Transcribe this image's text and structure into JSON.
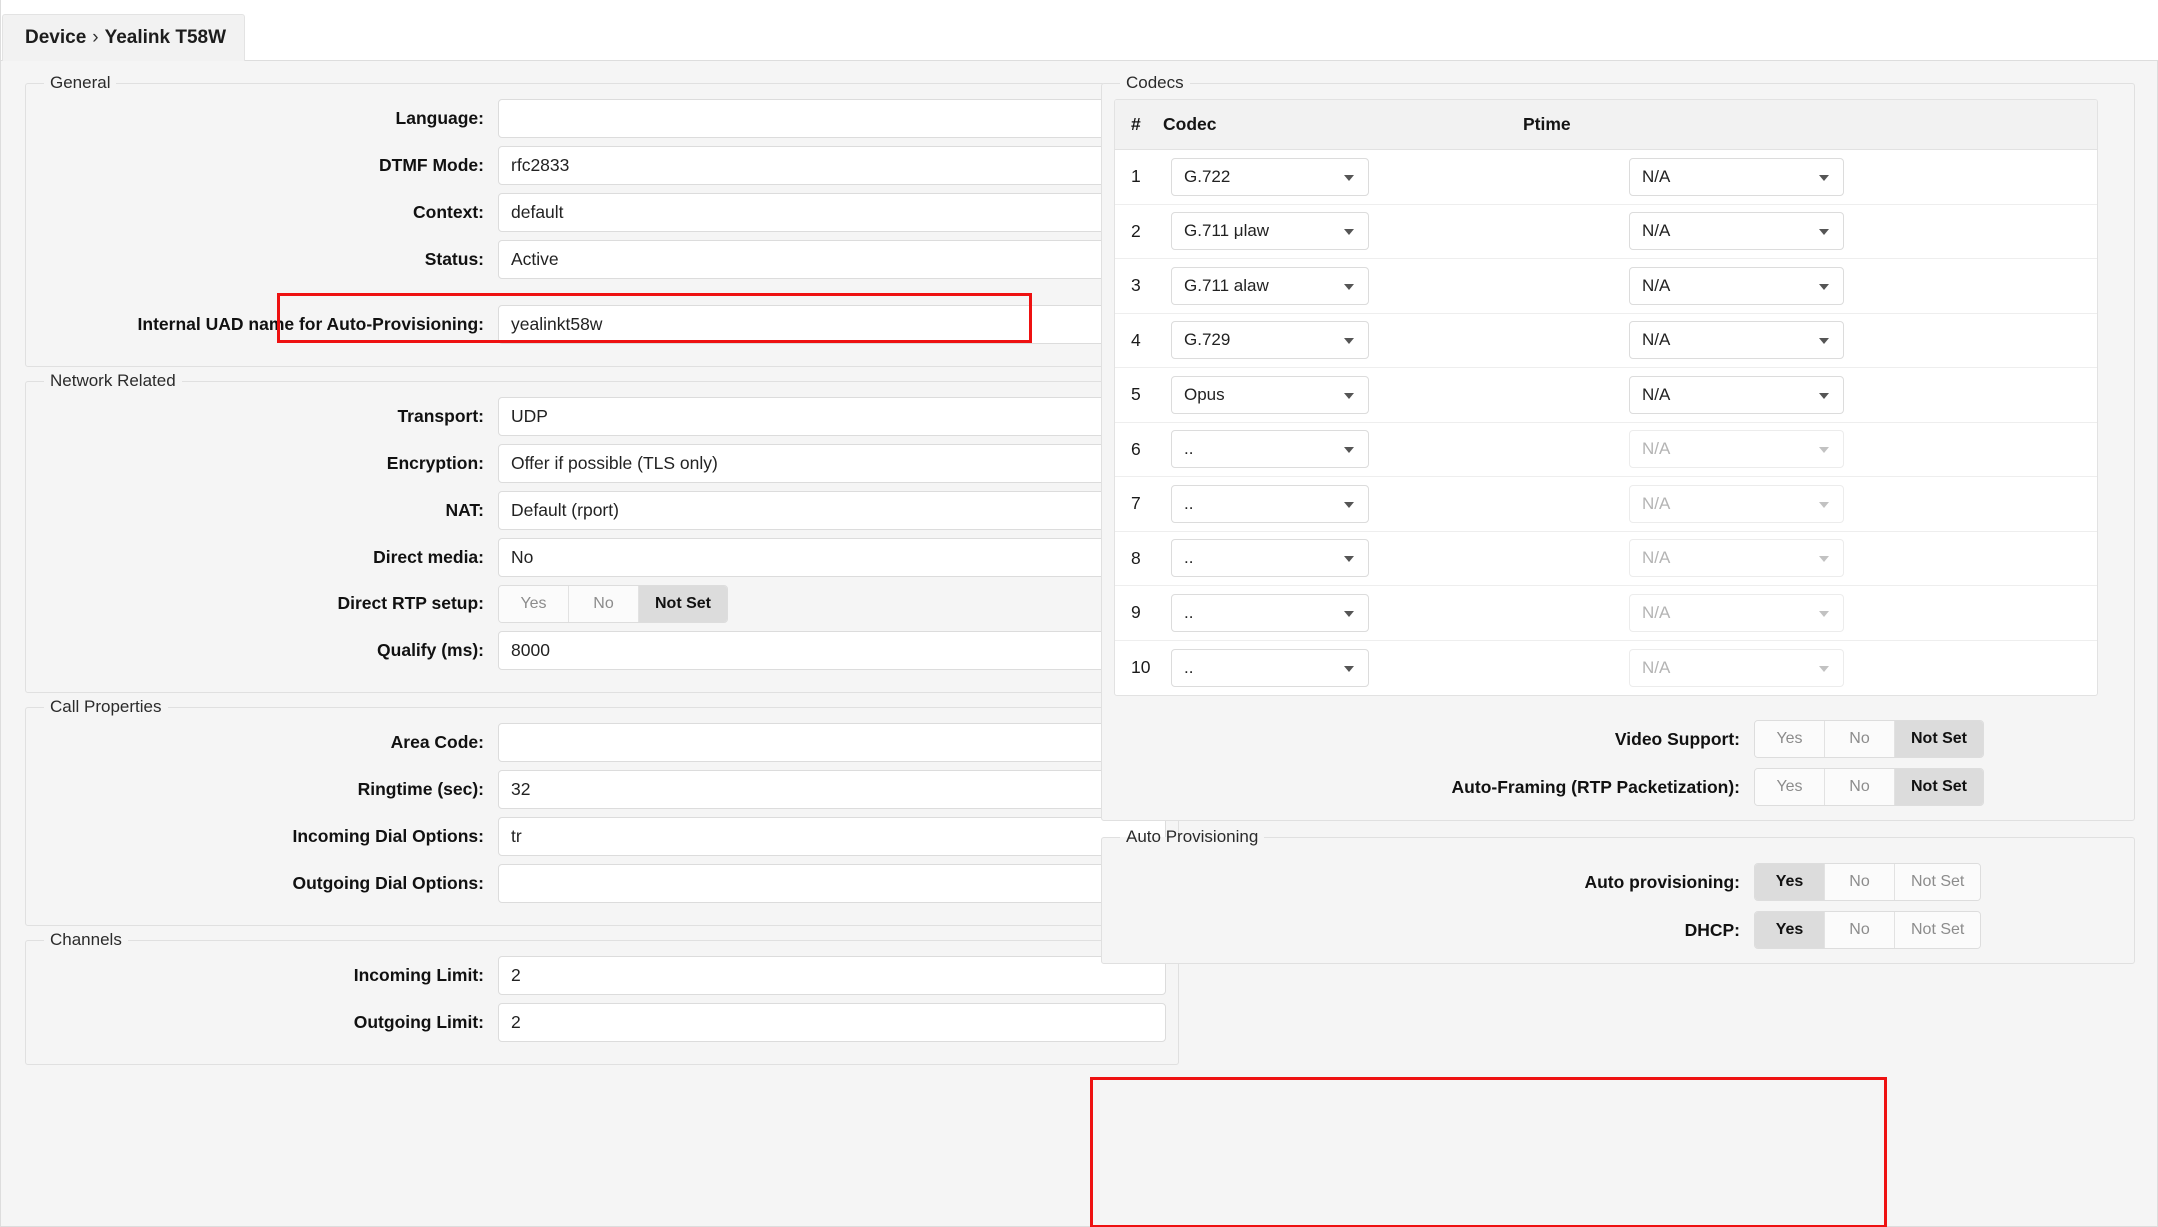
{
  "tab": {
    "root": "Device",
    "separator": "›",
    "name": "Yealink T58W"
  },
  "sections": {
    "general": {
      "legend": "General",
      "fields": [
        {
          "label": "Language:",
          "value": "",
          "type": "text"
        },
        {
          "label": "DTMF Mode:",
          "value": "rfc2833",
          "type": "select"
        },
        {
          "label": "Context:",
          "value": "default",
          "type": "text"
        },
        {
          "label": "Status:",
          "value": "Active",
          "type": "select",
          "highlighted": true
        },
        {
          "label": "Internal UAD name for Auto-Provisioning:",
          "value": "yealinkt58w",
          "type": "select"
        }
      ]
    },
    "network": {
      "legend": "Network Related",
      "fields": [
        {
          "label": "Transport:",
          "value": "UDP",
          "type": "select"
        },
        {
          "label": "Encryption:",
          "value": "Offer if possible (TLS only)",
          "type": "select"
        },
        {
          "label": "NAT:",
          "value": "Default (rport)",
          "type": "select"
        },
        {
          "label": "Direct media:",
          "value": "No",
          "type": "select"
        },
        {
          "label": "Direct RTP setup:",
          "type": "tristate",
          "options": [
            "Yes",
            "No",
            "Not Set"
          ],
          "selected": "Not Set"
        },
        {
          "label": "Qualify (ms):",
          "value": "8000",
          "type": "text"
        }
      ]
    },
    "call_properties": {
      "legend": "Call Properties",
      "fields": [
        {
          "label": "Area Code:",
          "value": "",
          "type": "text"
        },
        {
          "label": "Ringtime (sec):",
          "value": "32",
          "type": "text"
        },
        {
          "label": "Incoming Dial Options:",
          "value": "tr",
          "type": "text"
        },
        {
          "label": "Outgoing Dial Options:",
          "value": "",
          "type": "text"
        }
      ]
    },
    "channels": {
      "legend": "Channels",
      "fields": [
        {
          "label": "Incoming Limit:",
          "value": "2",
          "type": "text"
        },
        {
          "label": "Outgoing Limit:",
          "value": "2",
          "type": "text"
        }
      ]
    },
    "codecs": {
      "legend": "Codecs",
      "columns": [
        "#",
        "Codec",
        "Ptime"
      ],
      "rows": [
        {
          "n": "1",
          "codec": "G.722",
          "ptime": "N/A",
          "enabled": true
        },
        {
          "n": "2",
          "codec": "G.711 μlaw",
          "ptime": "N/A",
          "enabled": true
        },
        {
          "n": "3",
          "codec": "G.711 alaw",
          "ptime": "N/A",
          "enabled": true
        },
        {
          "n": "4",
          "codec": "G.729",
          "ptime": "N/A",
          "enabled": true
        },
        {
          "n": "5",
          "codec": "Opus",
          "ptime": "N/A",
          "enabled": true
        },
        {
          "n": "6",
          "codec": "..",
          "ptime": "N/A",
          "enabled": false
        },
        {
          "n": "7",
          "codec": "..",
          "ptime": "N/A",
          "enabled": false
        },
        {
          "n": "8",
          "codec": "..",
          "ptime": "N/A",
          "enabled": false
        },
        {
          "n": "9",
          "codec": "..",
          "ptime": "N/A",
          "enabled": false
        },
        {
          "n": "10",
          "codec": "..",
          "ptime": "N/A",
          "enabled": false
        }
      ],
      "toggles": [
        {
          "label": "Video Support:",
          "options": [
            "Yes",
            "No",
            "Not Set"
          ],
          "selected": "Not Set"
        },
        {
          "label": "Auto-Framing (RTP Packetization):",
          "options": [
            "Yes",
            "No",
            "Not Set"
          ],
          "selected": "Not Set"
        }
      ]
    },
    "auto_provisioning": {
      "legend": "Auto Provisioning",
      "highlighted": true,
      "fields": [
        {
          "label": "Auto provisioning:",
          "options": [
            "Yes",
            "No",
            "Not Set"
          ],
          "selected": "Yes"
        },
        {
          "label": "DHCP:",
          "options": [
            "Yes",
            "No",
            "Not Set"
          ],
          "selected": "Yes"
        }
      ]
    }
  },
  "colors": {
    "highlight": "#ee1111",
    "page_bg": "#f5f5f5",
    "field_bg": "#ffffff",
    "toggle_active": "#dcdcdc"
  }
}
